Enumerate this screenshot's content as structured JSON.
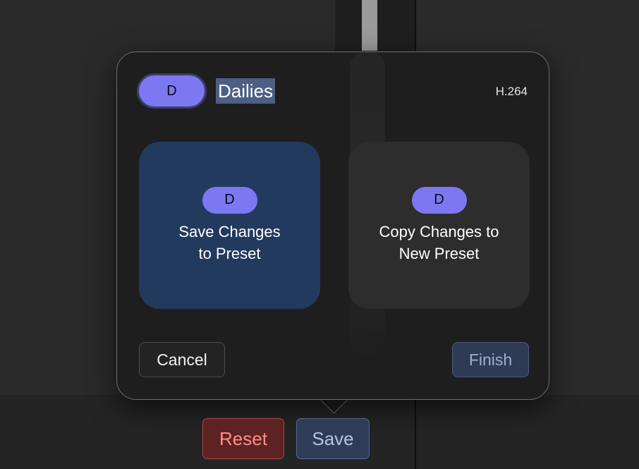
{
  "header": {
    "badge": "D",
    "title": "Dailies",
    "codec": "H.264"
  },
  "cards": {
    "save": {
      "badge": "D",
      "line1": "Save Changes",
      "line2": "to Preset"
    },
    "copy": {
      "badge": "D",
      "line1": "Copy Changes to",
      "line2": "New Preset"
    }
  },
  "dialog_buttons": {
    "cancel": "Cancel",
    "finish": "Finish"
  },
  "bottom_buttons": {
    "reset": "Reset",
    "save": "Save"
  },
  "colors": {
    "accent": "#7b78f2",
    "selected_card": "#233a5f",
    "reset": "#ff8c8c"
  }
}
